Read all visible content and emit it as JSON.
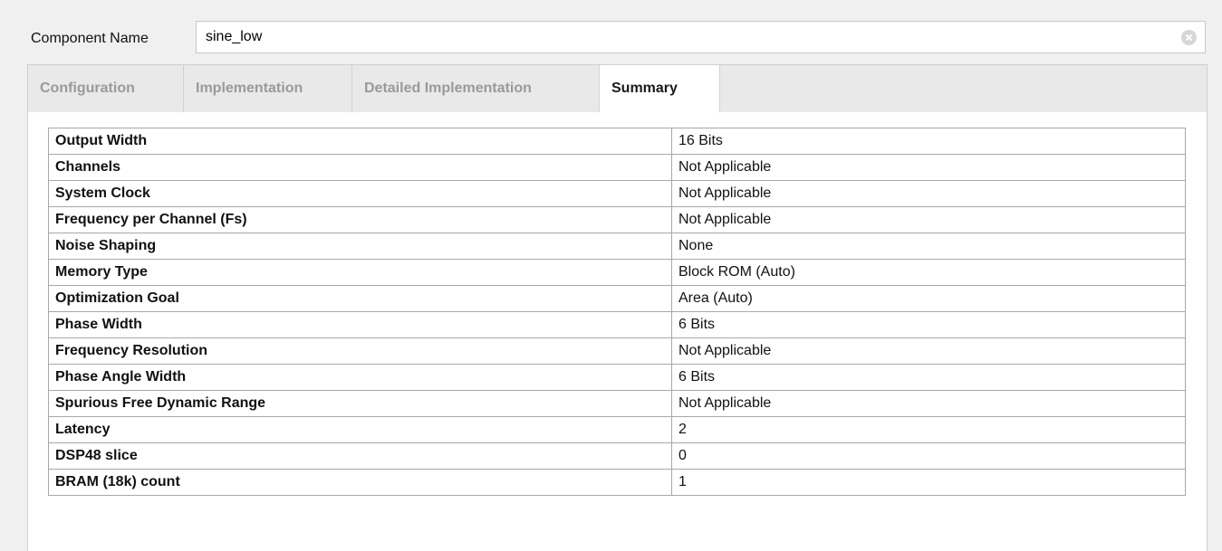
{
  "component": {
    "label": "Component Name",
    "value": "sine_low",
    "clear_icon": "clear-circle-icon"
  },
  "tabs": [
    {
      "label": "Configuration",
      "active": false
    },
    {
      "label": "Implementation",
      "active": false
    },
    {
      "label": "Detailed Implementation",
      "active": false
    },
    {
      "label": "Summary",
      "active": true
    }
  ],
  "summary": {
    "rows": [
      {
        "key": "Output Width",
        "value": "16 Bits"
      },
      {
        "key": "Channels",
        "value": "Not Applicable"
      },
      {
        "key": "System Clock",
        "value": "Not Applicable"
      },
      {
        "key": "Frequency per Channel (Fs)",
        "value": "Not Applicable"
      },
      {
        "key": "Noise Shaping",
        "value": "None"
      },
      {
        "key": "Memory Type",
        "value": "Block ROM (Auto)"
      },
      {
        "key": "Optimization Goal",
        "value": "Area (Auto)"
      },
      {
        "key": "Phase Width",
        "value": "6 Bits"
      },
      {
        "key": "Frequency Resolution",
        "value": "Not Applicable"
      },
      {
        "key": "Phase Angle Width",
        "value": "6 Bits"
      },
      {
        "key": "Spurious Free Dynamic Range",
        "value": "Not Applicable"
      },
      {
        "key": "Latency",
        "value": "2"
      },
      {
        "key": "DSP48 slice",
        "value": "0"
      },
      {
        "key": "BRAM (18k) count",
        "value": "1"
      }
    ]
  },
  "colors": {
    "background": "#f0f0f0",
    "tabbar": "#e9e9e9",
    "inactive_tab_text": "#9a9a9a",
    "table_border": "#a8a8a8"
  }
}
